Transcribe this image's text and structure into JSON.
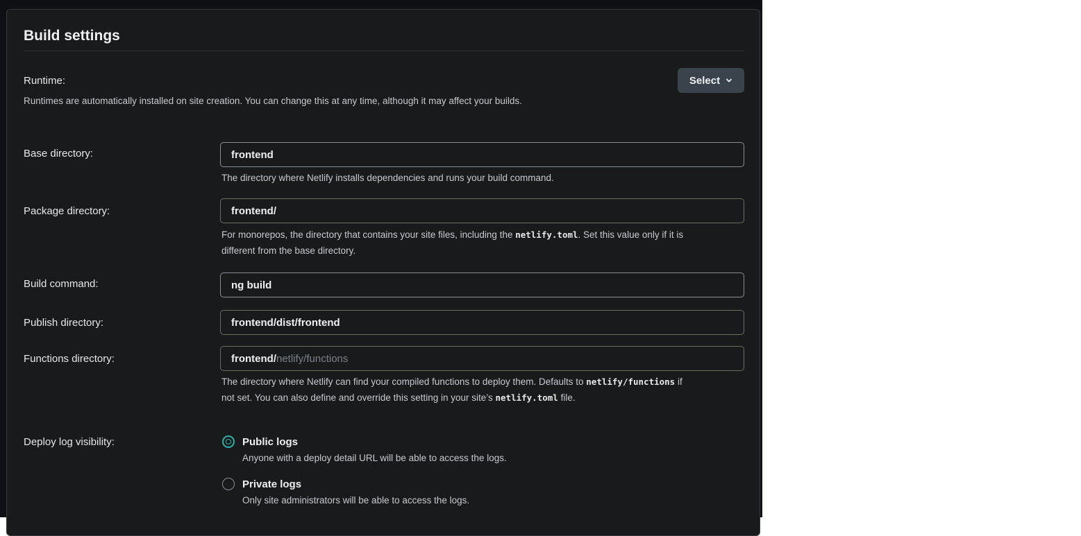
{
  "section": {
    "title": "Build settings"
  },
  "runtime": {
    "label": "Runtime:",
    "description": "Runtimes are automatically installed on site creation. You can change this at any time, although it may affect your builds.",
    "select_label": "Select"
  },
  "base_directory": {
    "label": "Base directory:",
    "value": "frontend",
    "help": "The directory where Netlify installs dependencies and runs your build command."
  },
  "package_directory": {
    "label": "Package directory:",
    "value": "frontend/",
    "help_part1": "For monorepos, the directory that contains your site files, including the ",
    "help_code": "netlify.toml",
    "help_part2": ". Set this value only if it is different from the base directory."
  },
  "build_command": {
    "label": "Build command:",
    "value": "ng build"
  },
  "publish_directory": {
    "label": "Publish directory:",
    "value": "frontend/dist/frontend"
  },
  "functions_directory": {
    "label": "Functions directory:",
    "prefix": "frontend/",
    "placeholder": "netlify/functions",
    "help_part1": "The directory where Netlify can find your compiled functions to deploy them. Defaults to ",
    "help_code1": "netlify/functions",
    "help_part2": " if not set. You can also define and override this setting in your site’s ",
    "help_code2": "netlify.toml",
    "help_part3": " file."
  },
  "deploy_log": {
    "label": "Deploy log visibility:",
    "options": [
      {
        "label": "Public logs",
        "description": "Anyone with a deploy detail URL will be able to access the logs.",
        "selected": true
      },
      {
        "label": "Private logs",
        "description": "Only site administrators will be able to access the logs.",
        "selected": false
      }
    ]
  },
  "colors": {
    "panel_bg": "#181a1c",
    "accent_radio": "#2bb3a7",
    "select_button_bg": "#3a434c"
  }
}
